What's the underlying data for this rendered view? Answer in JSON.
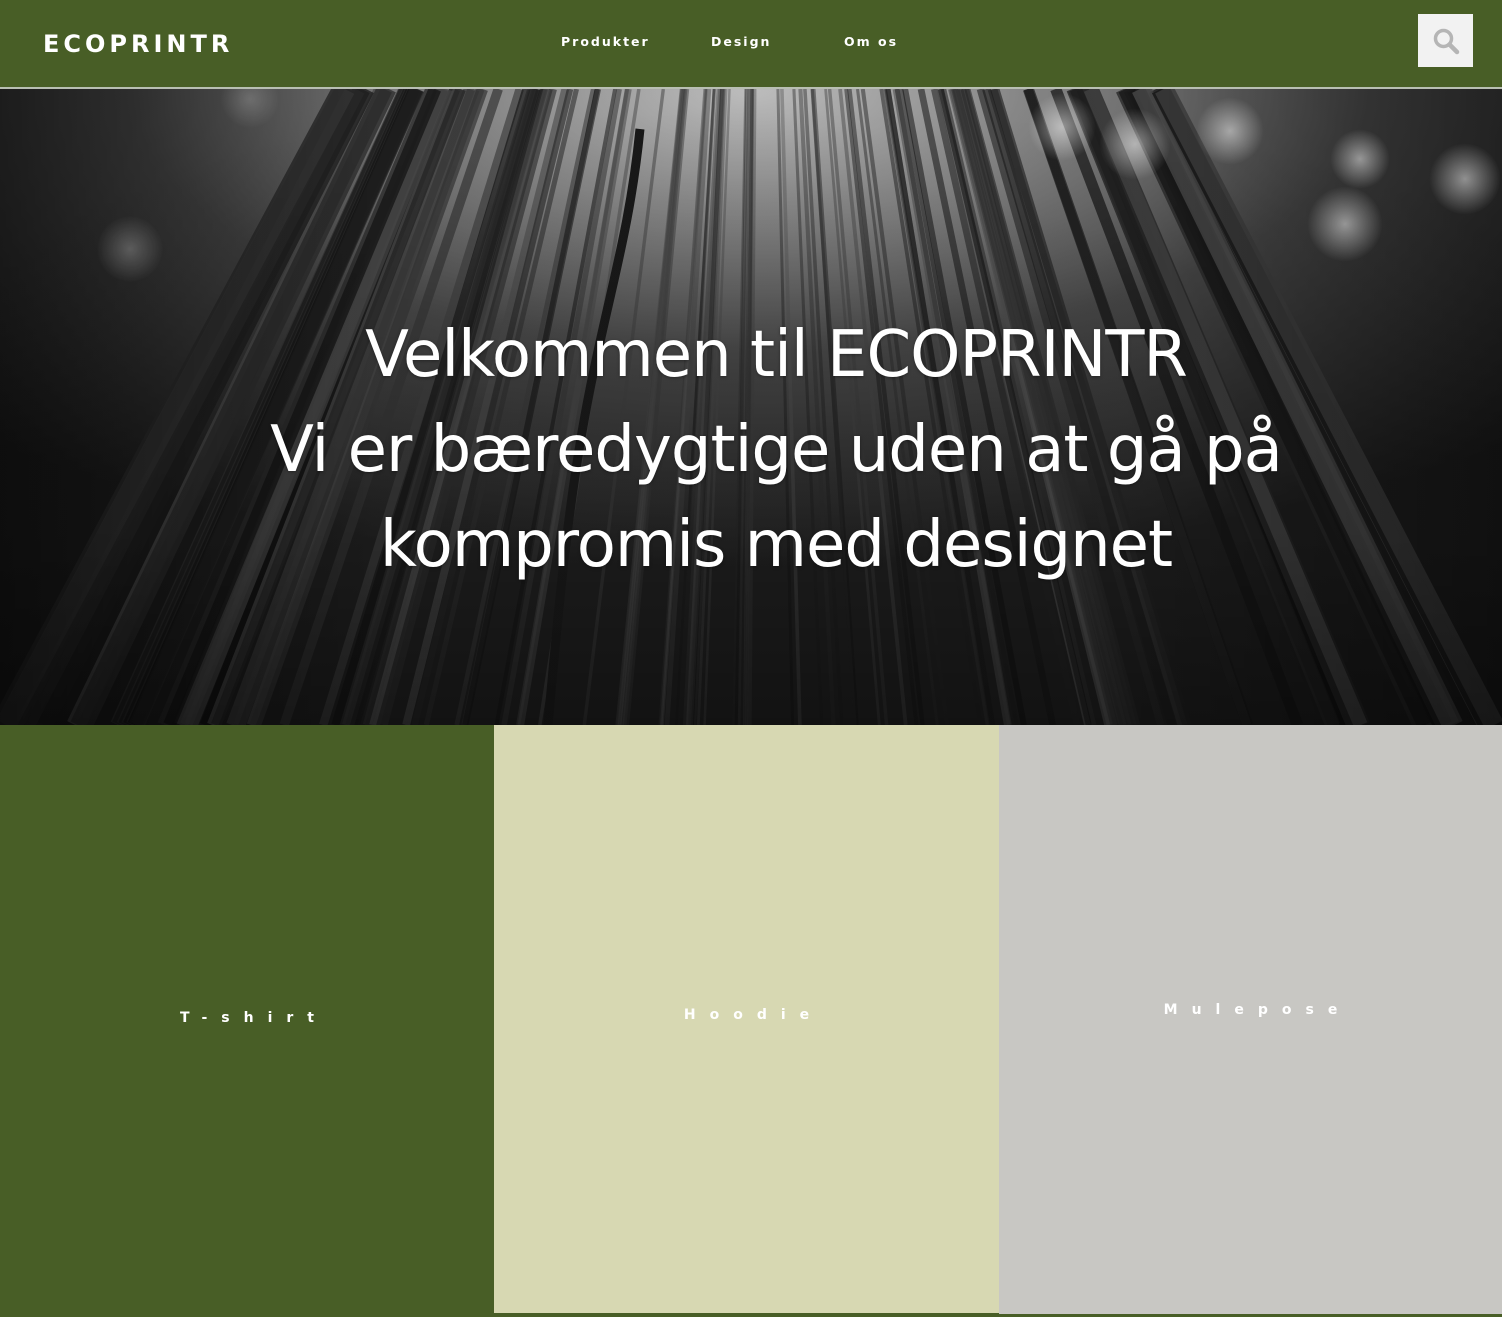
{
  "header": {
    "logo": "ECOPRINTR",
    "nav": [
      {
        "label": "Produkter"
      },
      {
        "label": "Design"
      },
      {
        "label": "Om os"
      }
    ],
    "search_icon": "search-icon"
  },
  "hero": {
    "lines": [
      "Velkommen til ECOPRINTR",
      "Vi er bæredygtige uden at gå på",
      "kompromis med designet"
    ]
  },
  "products": [
    {
      "label": "T-shirt",
      "color": "#485e26"
    },
    {
      "label": "Hoodie",
      "color": "#d7d8b2"
    },
    {
      "label": "Mulepose",
      "color": "#c8c7c3"
    }
  ],
  "colors": {
    "brand_green": "#485e26",
    "search_bg": "#f2f2f2"
  }
}
